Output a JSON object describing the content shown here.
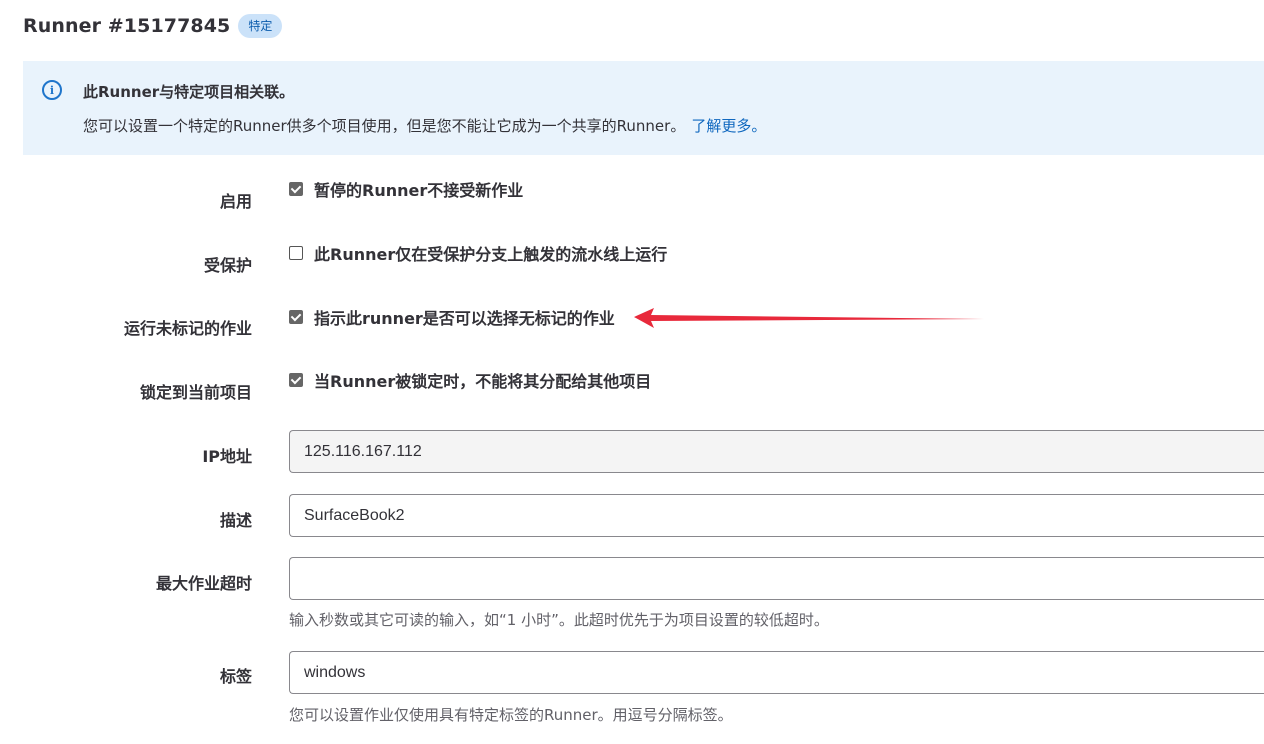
{
  "header": {
    "title": "Runner #15177845",
    "badge": "特定"
  },
  "alert": {
    "icon": "info-icon",
    "title": "此Runner与特定项目相关联。",
    "body": "您可以设置一个特定的Runner供多个项目使用，但是您不能让它成为一个共享的Runner。",
    "link": "了解更多。"
  },
  "settings": {
    "active": {
      "label": "启用",
      "checkbox_label": "暂停的Runner不接受新作业",
      "checked": true
    },
    "protected": {
      "label": "受保护",
      "checkbox_label": "此Runner仅在受保护分支上触发的流水线上运行",
      "checked": false
    },
    "untagged": {
      "label": "运行未标记的作业",
      "checkbox_label": "指示此runner是否可以选择无标记的作业",
      "checked": true
    },
    "locked": {
      "label": "锁定到当前项目",
      "checkbox_label": "当Runner被锁定时，不能将其分配给其他项目",
      "checked": true
    },
    "ip": {
      "label": "IP地址",
      "value": "125.116.167.112"
    },
    "description": {
      "label": "描述",
      "value": "SurfaceBook2"
    },
    "timeout": {
      "label": "最大作业超时",
      "value": "",
      "help": "输入秒数或其它可读的输入，如“1 小时”。此超时优先于为项目设置的较低超时。"
    },
    "tags": {
      "label": "标签",
      "value": "windows",
      "help": "您可以设置作业仅使用具有特定标签的Runner。用逗号分隔标签。"
    }
  },
  "colors": {
    "annotation_arrow": "#e8293b",
    "link": "#1068bf",
    "alert_bg": "#e9f3fc"
  }
}
